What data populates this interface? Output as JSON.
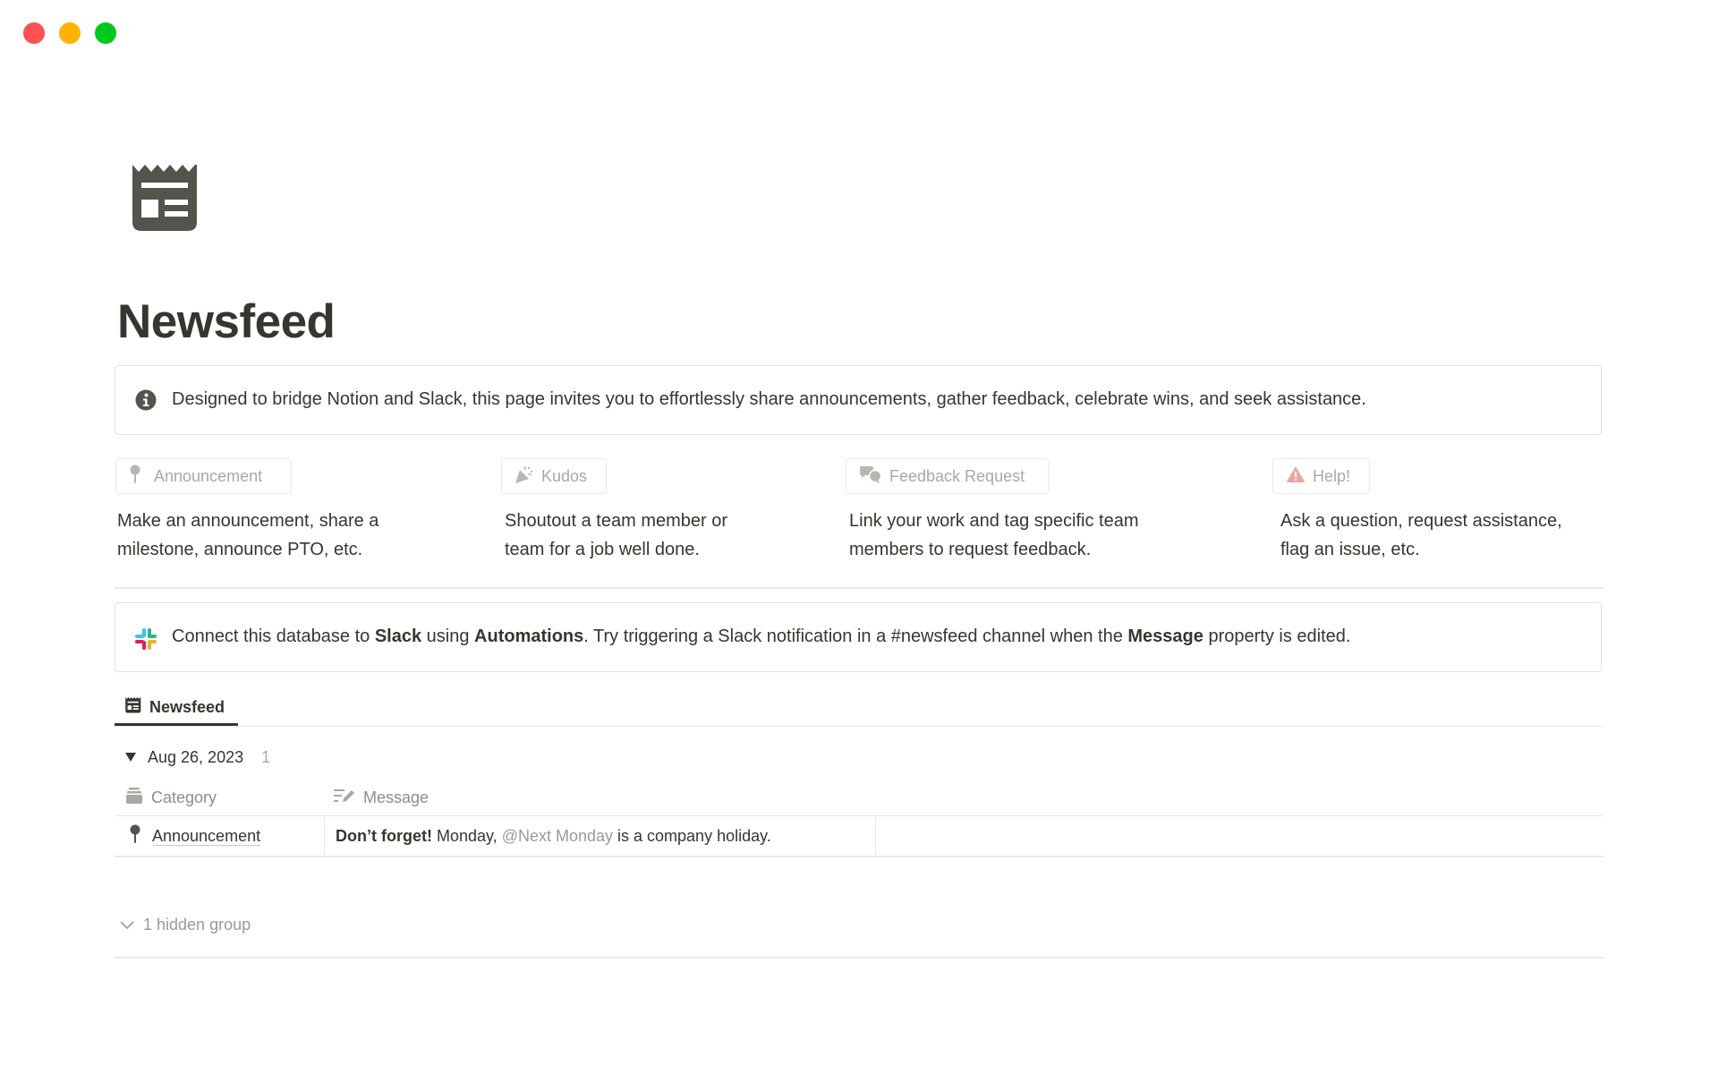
{
  "window": {
    "controls": [
      "close",
      "minimize",
      "maximize"
    ],
    "colors": {
      "close": "#ff5153",
      "minimize": "#ffb300",
      "maximize": "#00c91e"
    }
  },
  "page": {
    "icon": "newspaper-icon",
    "title": "Newsfeed"
  },
  "intro_callout": {
    "icon": "info-icon",
    "text": "Designed to bridge Notion and Slack, this page invites you to effortlessly share announcements, gather feedback, celebrate wins, and seek assistance."
  },
  "actions": [
    {
      "label": "Announcement",
      "icon": "pin-icon",
      "description_line1": "Make an announcement, share a",
      "description_line2": "milestone, announce PTO, etc."
    },
    {
      "label": "Kudos",
      "icon": "party-popper-icon",
      "description_line1": "Shoutout a team member or",
      "description_line2": "team for a job well done."
    },
    {
      "label": "Feedback Request",
      "icon": "chat-bubbles-icon",
      "description_line1": "Link your work and tag specific team",
      "description_line2": "members to request feedback."
    },
    {
      "label": "Help!",
      "icon": "warning-icon",
      "icon_color": "#e8a7a5",
      "description_line1": "Ask a question, request assistance,",
      "description_line2": "flag an issue, etc."
    }
  ],
  "slack_callout": {
    "icon": "slack-icon",
    "parts": {
      "p1": "Connect this database to ",
      "b1": "Slack",
      "p2": " using ",
      "b2": "Automations",
      "p3": ". Try triggering a Slack notification in a #newsfeed channel when the ",
      "b3": "Message",
      "p4": " property is edited."
    }
  },
  "database": {
    "view_tab": {
      "label": "Newsfeed",
      "icon": "newspaper-icon"
    },
    "group": {
      "title": "Aug 26, 2023",
      "count": "1",
      "expanded": true
    },
    "columns": [
      {
        "label": "Category",
        "icon": "archive-stack-icon"
      },
      {
        "label": "Message",
        "icon": "text-edit-icon"
      }
    ],
    "rows": [
      {
        "category": "Announcement",
        "category_icon": "pin-icon",
        "message_bold": "Don’t forget!",
        "message_pre": "Monday,",
        "message_mention": "@Next Monday",
        "message_post": "is a company holiday."
      }
    ],
    "hidden_groups_label": "1 hidden group"
  },
  "colors": {
    "text": "#37352f",
    "muted": "#a9a8a5",
    "border": "#e9e9e7"
  }
}
